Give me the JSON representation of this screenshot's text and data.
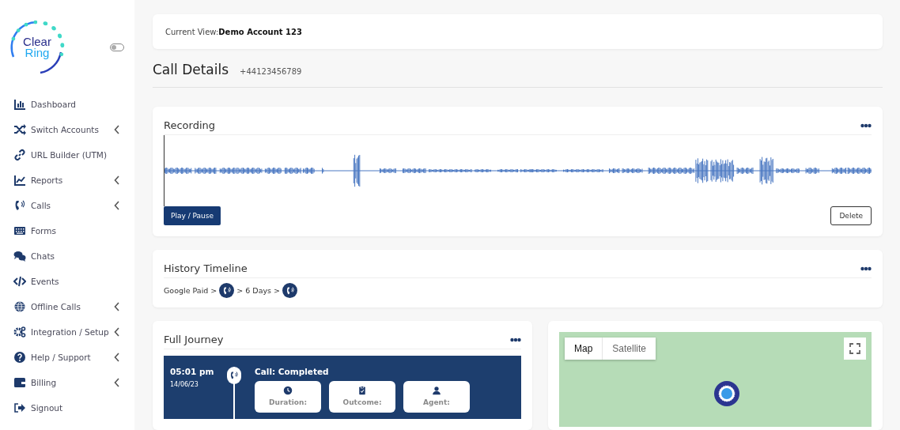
{
  "sidebar": {
    "logo": {
      "line_1": "Clear",
      "line_2": "Ring"
    },
    "toggle": {
      "on": false
    },
    "items": [
      {
        "label": "Dashboard",
        "expandable": false
      },
      {
        "label": "Switch Accounts",
        "expandable": true
      },
      {
        "label": "URL Builder (UTM)",
        "expandable": false
      },
      {
        "label": "Reports",
        "expandable": true
      },
      {
        "label": "Calls",
        "expandable": true
      },
      {
        "label": "Forms",
        "expandable": false
      },
      {
        "label": "Chats",
        "expandable": false
      },
      {
        "label": "Events",
        "expandable": false
      },
      {
        "label": "Offline Calls",
        "expandable": true
      },
      {
        "label": "Integration / Setup",
        "expandable": true
      },
      {
        "label": "Help / Support",
        "expandable": true
      },
      {
        "label": "Billing",
        "expandable": true
      },
      {
        "label": "Signout",
        "expandable": false
      }
    ]
  },
  "current_view": {
    "label": "Current View:",
    "value": "Demo Account 123"
  },
  "page_header": {
    "title": "Call Details",
    "number": "+44123456789"
  },
  "recording": {
    "title": "Recording",
    "play_button": "Play / Pause",
    "delete_button": "Delete"
  },
  "history": {
    "title": "History Timeline",
    "steps": [
      {
        "kind": "text",
        "text": "Google Paid >"
      },
      {
        "kind": "call"
      },
      {
        "kind": "text",
        "text": "> 6 Days >"
      },
      {
        "kind": "call"
      }
    ]
  },
  "journey": {
    "title": "Full Journey",
    "time": "05:01 pm",
    "date": "14/06/23",
    "status": "Call: Completed",
    "tiles": [
      {
        "label": "Duration:"
      },
      {
        "label": "Outcome:"
      },
      {
        "label": "Agent:"
      }
    ]
  },
  "map": {
    "types": [
      {
        "label": "Map",
        "selected": true
      },
      {
        "label": "Satellite",
        "selected": false
      }
    ]
  }
}
